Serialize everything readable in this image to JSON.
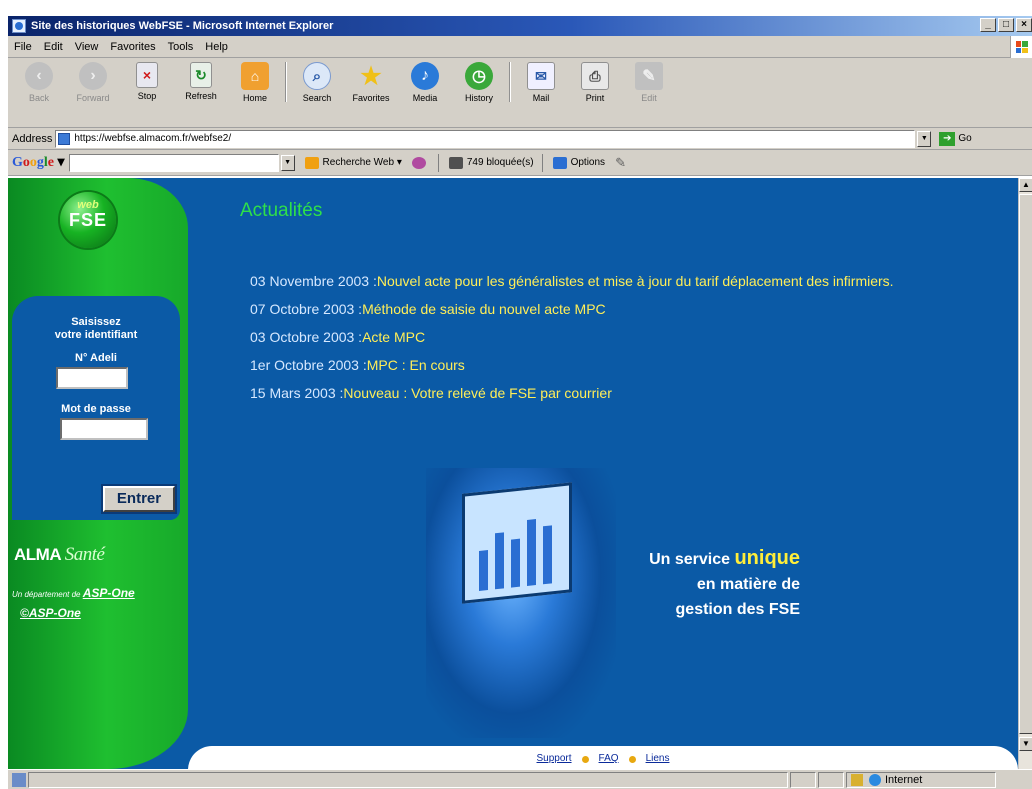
{
  "window": {
    "title": "Site des historiques WebFSE - Microsoft Internet Explorer",
    "buttons": [
      "_",
      "□",
      "×"
    ]
  },
  "menu": [
    "File",
    "Edit",
    "View",
    "Favorites",
    "Tools",
    "Help"
  ],
  "toolbar": {
    "back": "Back",
    "forward": "Forward",
    "stop": "Stop",
    "refresh": "Refresh",
    "home": "Home",
    "search": "Search",
    "favorites": "Favorites",
    "media": "Media",
    "history": "History",
    "mail": "Mail",
    "print": "Print",
    "edit": "Edit"
  },
  "address": {
    "label": "Address",
    "url": "https://webfse.almacom.fr/webfse2/",
    "go": "Go"
  },
  "googlebar": {
    "logo": "Google",
    "search_web": "Recherche Web",
    "blocked": "749 bloquée(s)",
    "options": "Options"
  },
  "sidebar": {
    "logo_top": "web",
    "logo_bottom": "FSE",
    "login_title_1": "Saisissez",
    "login_title_2": "votre identifiant",
    "adeli_label": "N° Adeli",
    "password_label": "Mot de passe",
    "enter_label": "Entrer",
    "alma_1": "ALMA",
    "alma_2": "Santé",
    "dept_text": "Un département de ",
    "dept_link": "ASP-One",
    "copyright": "©ASP-One"
  },
  "news": {
    "title": "Actualités",
    "items": [
      {
        "date": "03 Novembre 2003 :",
        "text": "Nouvel acte pour les généralistes et mise à jour du tarif déplacement des infirmiers."
      },
      {
        "date": "07 Octobre 2003 :",
        "text": "Méthode de saisie du nouvel acte MPC"
      },
      {
        "date": "03 Octobre 2003 :",
        "text": "Acte MPC"
      },
      {
        "date": "1er Octobre 2003 :",
        "text": "MPC : En cours"
      },
      {
        "date": "15 Mars 2003 :",
        "text": "Nouveau : Votre relevé de FSE par courrier"
      }
    ]
  },
  "promo": {
    "line1_prefix": "Un service ",
    "line1_highlight": "unique",
    "line2": "en matière de",
    "line3": "gestion des FSE"
  },
  "footer": {
    "support": "Support",
    "faq": "FAQ",
    "links": "Liens"
  },
  "status": {
    "zone": "Internet"
  },
  "colors": {
    "page_blue": "#0b5aa6",
    "sidebar_green": "#1fbf30",
    "news_title": "#2ee04a",
    "news_link": "#ffee58",
    "highlight": "#ffee3a"
  }
}
